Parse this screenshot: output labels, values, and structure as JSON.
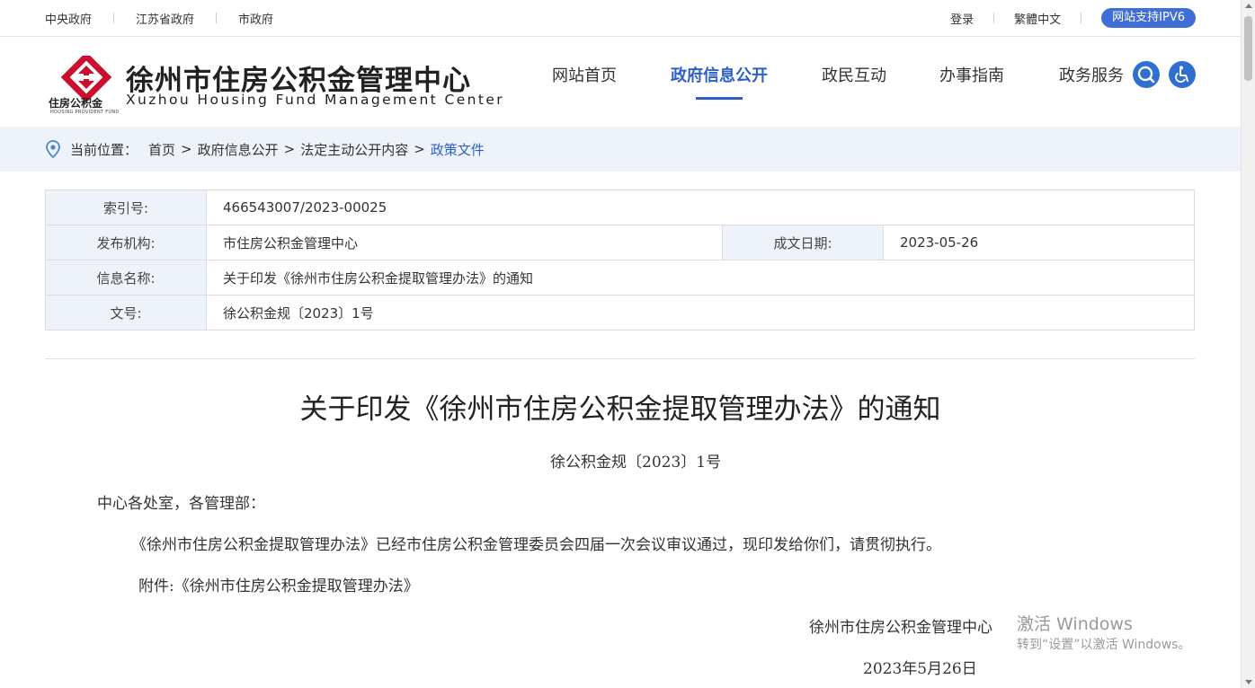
{
  "topbar": {
    "links": [
      "中央政府",
      "江苏省政府",
      "市政府"
    ],
    "login": "登录",
    "traditional": "繁體中文",
    "ipv6": "网站支持IPV6"
  },
  "logo": {
    "title": "徐州市住房公积金管理中心",
    "subtitle": "Xuzhou Housing Fund Management Center",
    "small_cn": "住房公积金",
    "small_en": "HOUSING PROVIDENT FUND"
  },
  "nav": {
    "items": [
      "网站首页",
      "政府信息公开",
      "政民互动",
      "办事指南",
      "政务服务"
    ],
    "active": "政府信息公开"
  },
  "breadcrumb": {
    "label": "当前位置：",
    "items": [
      "首页",
      "政府信息公开",
      "法定主动公开内容"
    ],
    "current": "政策文件"
  },
  "info": {
    "index_label": "索引号:",
    "index_value": "466543007/2023-00025",
    "org_label": "发布机构:",
    "org_value": "市住房公积金管理中心",
    "date_label": "成文日期:",
    "date_value": "2023-05-26",
    "name_label": "信息名称:",
    "name_value": "关于印发《徐州市住房公积金提取管理办法》的通知",
    "docno_label": "文号:",
    "docno_value": "徐公积金规〔2023〕1号"
  },
  "document": {
    "title": "关于印发《徐州市住房公积金提取管理办法》的通知",
    "doc_number": "徐公积金规〔2023〕1号",
    "salutation": "中心各处室，各管理部：",
    "body": "《徐州市住房公积金提取管理办法》已经市住房公积金管理委员会四届一次会议审议通过，现印发给你们，请贯彻执行。",
    "attachment": "附件:《徐州市住房公积金提取管理办法》",
    "signature": "徐州市住房公积金管理中心",
    "date": "2023年5月26日"
  },
  "watermark": {
    "line1": "激活 Windows",
    "line2": "转到“设置”以激活 Windows。"
  },
  "colors": {
    "accent": "#2f5fc8",
    "logo_red": "#c8102e",
    "crumb_bg": "#eef3fa"
  }
}
